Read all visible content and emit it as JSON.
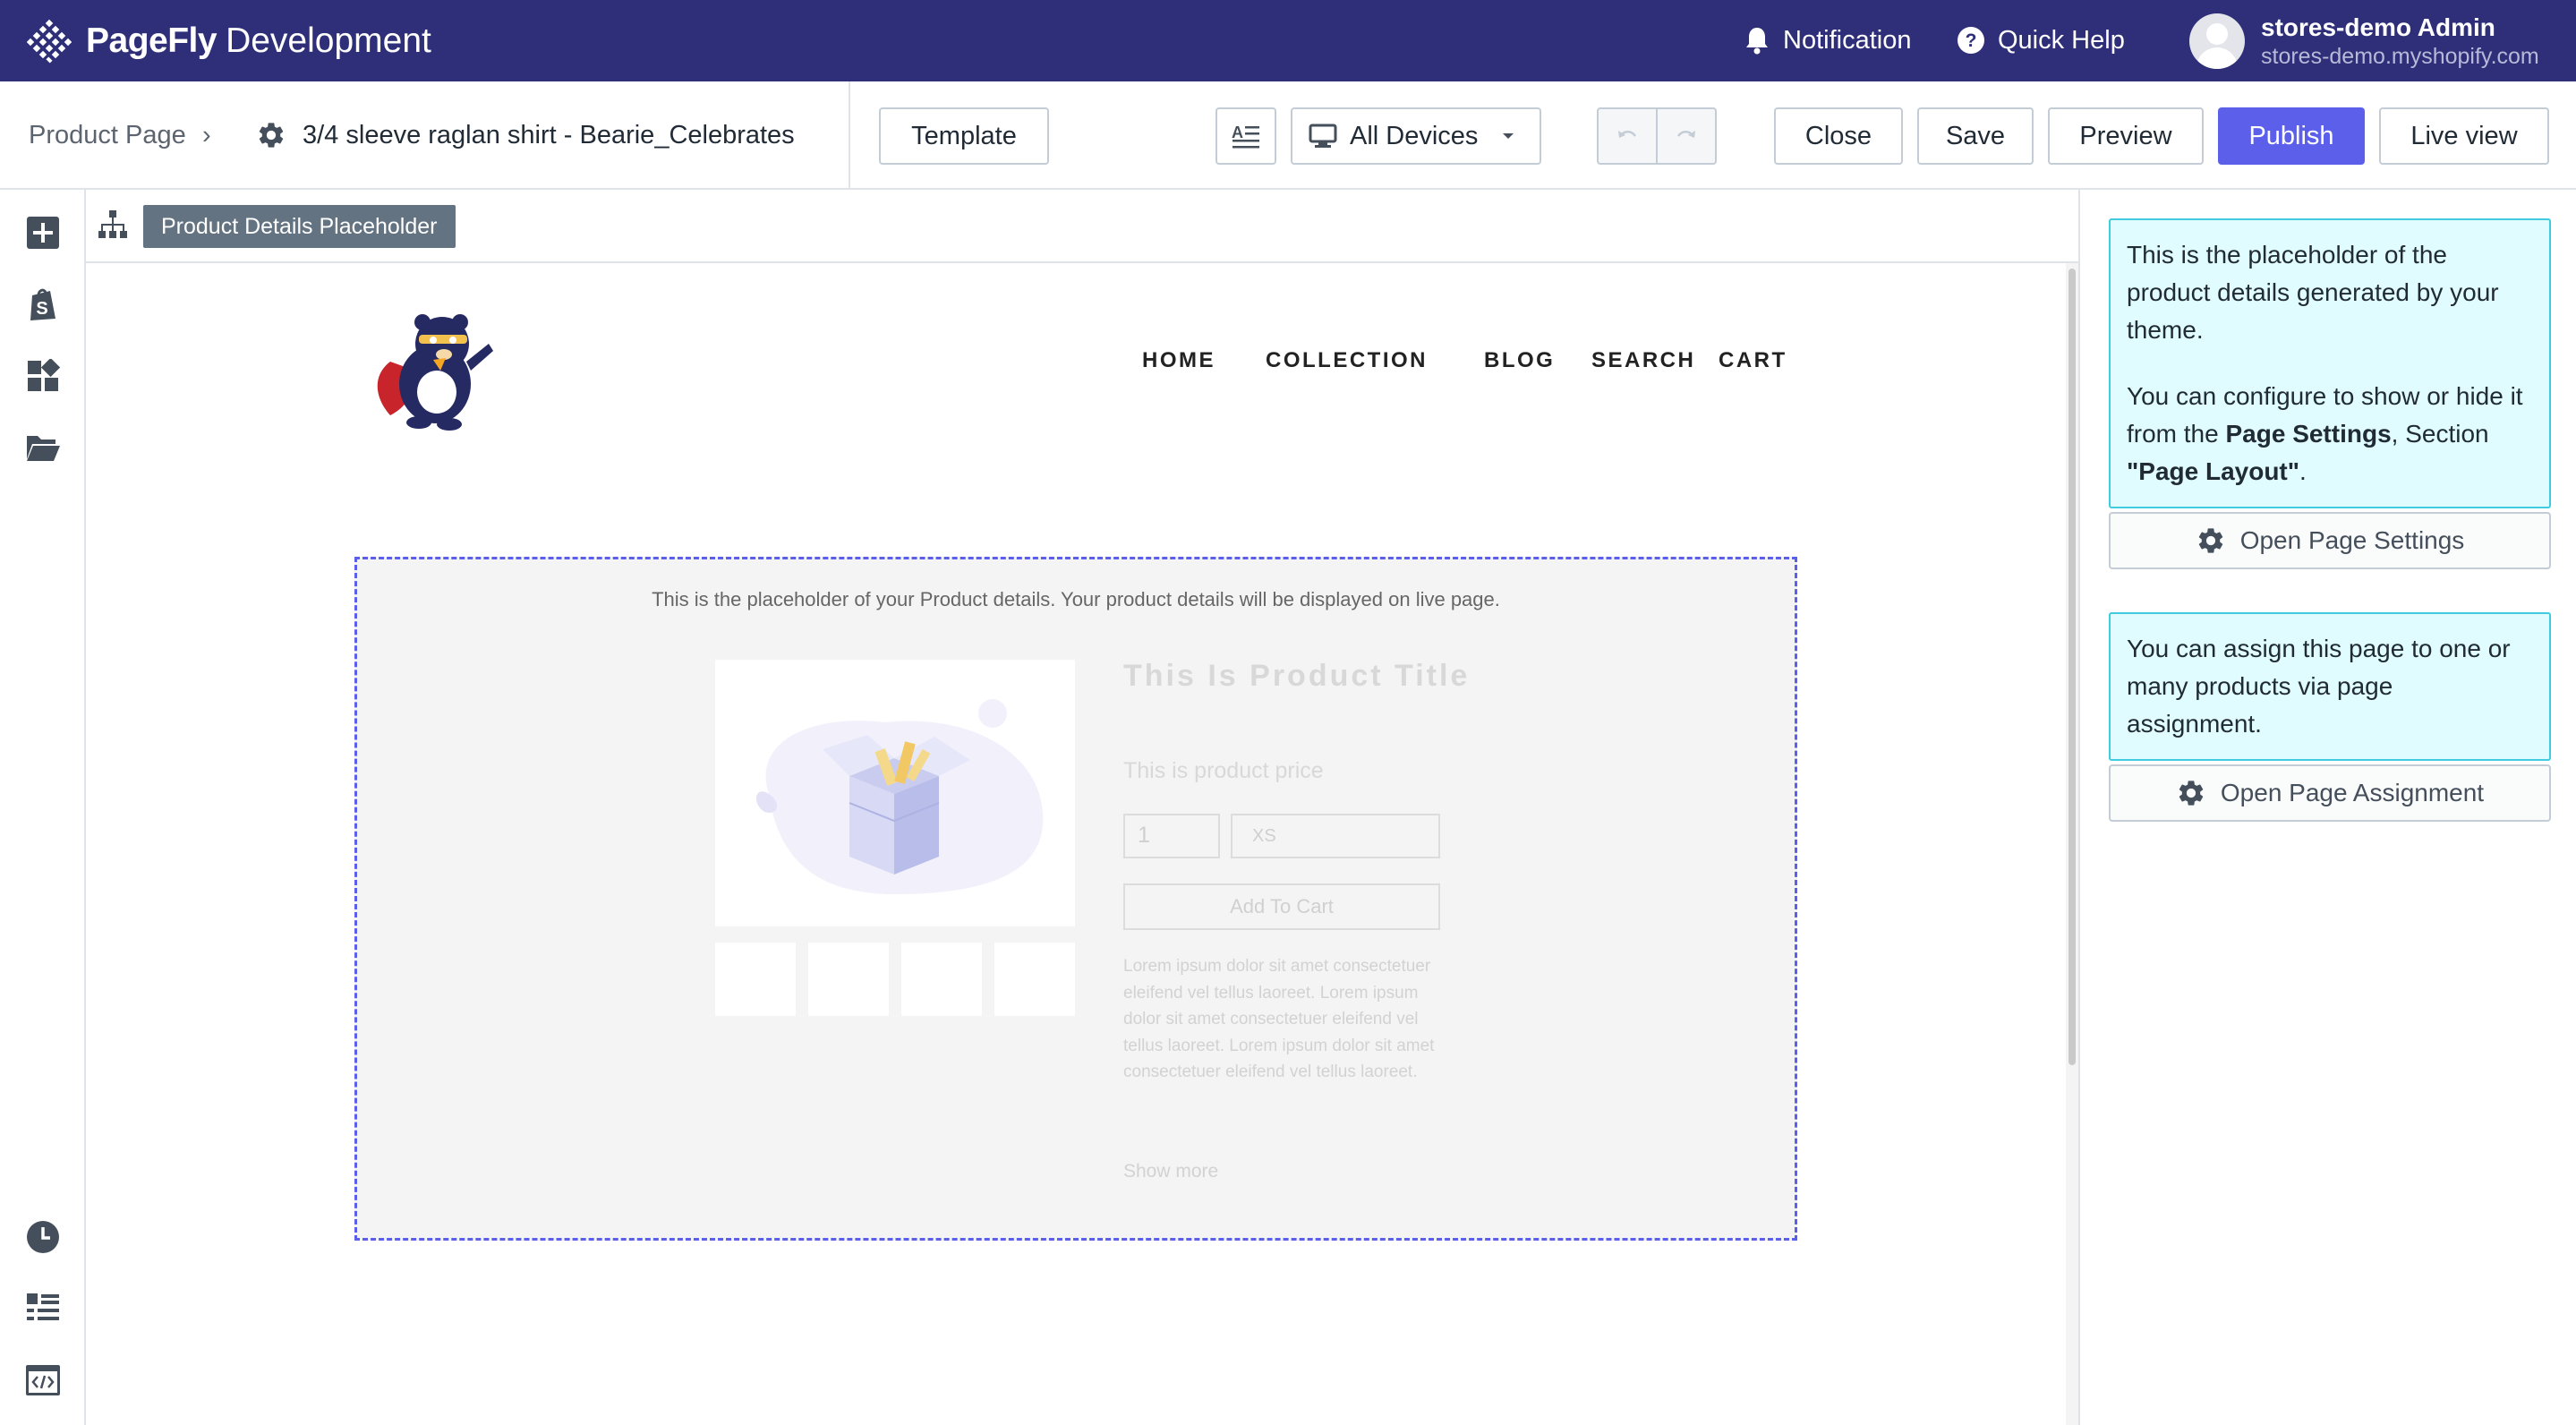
{
  "app": {
    "brand_name": "PageFly",
    "brand_sub": "Development",
    "notification_label": "Notification",
    "quick_help_label": "Quick Help",
    "user_name": "stores-demo Admin",
    "user_shop": "stores-demo.myshopify.com"
  },
  "toolbar": {
    "breadcrumb_root": "Product Page",
    "breadcrumb_separator": "›",
    "page_name": "3/4 sleeve raglan shirt - Bearie_Celebrates",
    "template_label": "Template",
    "device_label": "All Devices",
    "close_label": "Close",
    "save_label": "Save",
    "preview_label": "Preview",
    "publish_label": "Publish",
    "live_view_label": "Live view"
  },
  "canvas": {
    "selected_element": "Product Details Placeholder",
    "store_nav": [
      "HOME",
      "COLLECTION",
      "BLOG",
      "SEARCH",
      "CART"
    ],
    "placeholder": {
      "note": "This is the placeholder of your Product details. Your product details will be displayed on live page.",
      "product_title": "This Is Product Title",
      "product_price": "This is product price",
      "quantity": "1",
      "variant": "XS",
      "add_to_cart": "Add To Cart",
      "description": "Lorem ipsum dolor sit amet consectetuer eleifend vel tellus laoreet. Lorem ipsum dolor sit amet consectetuer eleifend vel tellus laoreet. Lorem ipsum dolor sit amet consectetuer eleifend vel tellus laoreet.",
      "show_more": "Show more"
    }
  },
  "panel": {
    "info1_p1": "This is the placeholder of the product details generated by your theme.",
    "info1_p2_pre": "You can configure to show or hide it from the ",
    "info1_p2_bold1": "Page Settings",
    "info1_p2_mid": ", Section ",
    "info1_p2_bold2": "\"Page Layout\"",
    "info1_p2_end": ".",
    "open_settings_label": "Open Page Settings",
    "info2": "You can assign this page to one or many products via page assignment.",
    "open_assignment_label": "Open Page Assignment"
  },
  "icons": {
    "left_top": [
      "add-element-icon",
      "shopify-icon",
      "widgets-icon",
      "folder-icon"
    ],
    "left_bottom": [
      "history-icon",
      "outline-icon",
      "custom-code-icon"
    ]
  },
  "colors": {
    "topbar": "#2e2f78",
    "primary": "#5b5fea",
    "info_bg": "#e0fcff",
    "info_border": "#3fcbe0",
    "chip": "#637381"
  }
}
